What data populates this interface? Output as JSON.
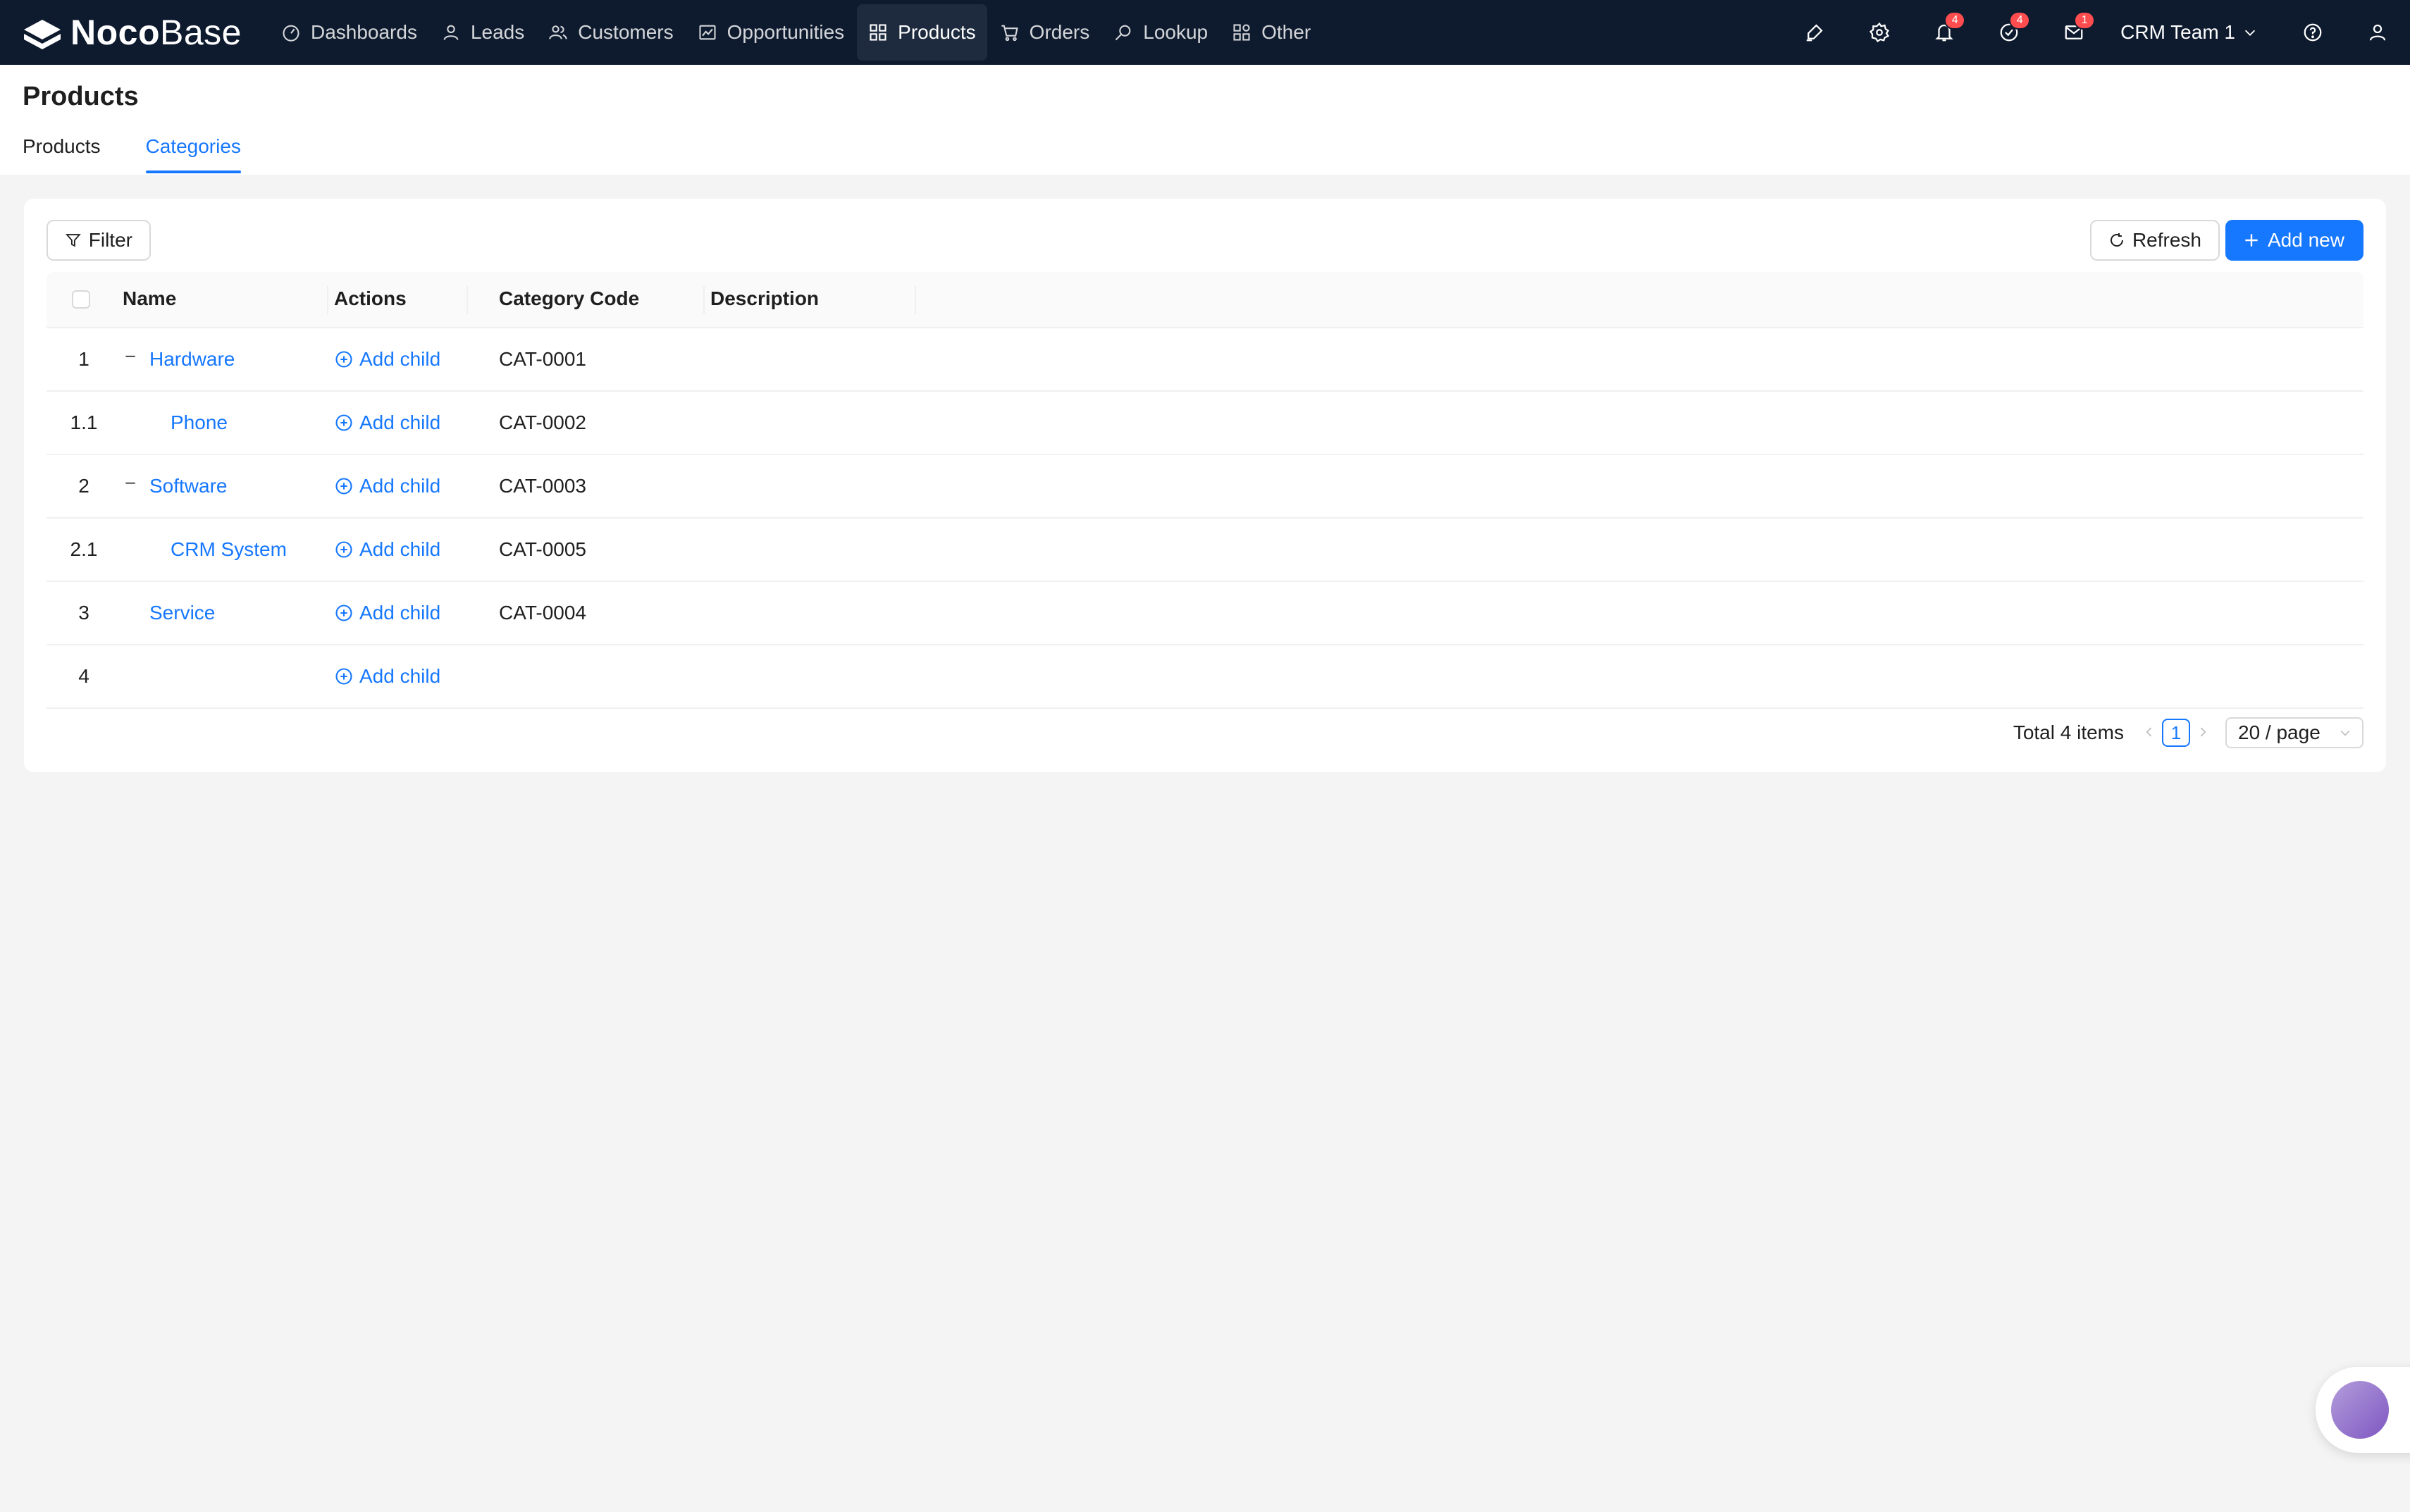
{
  "app": {
    "logo_bold": "Noco",
    "logo_light": "Base"
  },
  "nav": {
    "items": [
      {
        "label": "Dashboards",
        "icon": "dashboard-icon"
      },
      {
        "label": "Leads",
        "icon": "user-icon"
      },
      {
        "label": "Customers",
        "icon": "team-icon"
      },
      {
        "label": "Opportunities",
        "icon": "chart-icon"
      },
      {
        "label": "Products",
        "icon": "grid-icon",
        "active": true
      },
      {
        "label": "Orders",
        "icon": "cart-icon"
      },
      {
        "label": "Lookup",
        "icon": "search-icon"
      },
      {
        "label": "Other",
        "icon": "apps-icon"
      }
    ],
    "badges": {
      "notifications": "4",
      "tasks": "4",
      "mail": "1"
    },
    "team": "CRM Team 1"
  },
  "page": {
    "title": "Products",
    "tabs": [
      "Products",
      "Categories"
    ],
    "active_tab": "Categories"
  },
  "toolbar": {
    "filter": "Filter",
    "refresh": "Refresh",
    "add_new": "Add new"
  },
  "table": {
    "columns": [
      "Name",
      "Actions",
      "Category Code",
      "Description"
    ],
    "rows": [
      {
        "index": "1",
        "name": "Hardware",
        "action": "Add child",
        "code": "CAT-0001",
        "description": "",
        "expandable": true,
        "level": 0
      },
      {
        "index": "1.1",
        "name": "Phone",
        "action": "Add child",
        "code": "CAT-0002",
        "description": "",
        "expandable": false,
        "level": 1
      },
      {
        "index": "2",
        "name": "Software",
        "action": "Add child",
        "code": "CAT-0003",
        "description": "",
        "expandable": true,
        "level": 0
      },
      {
        "index": "2.1",
        "name": "CRM System",
        "action": "Add child",
        "code": "CAT-0005",
        "description": "",
        "expandable": false,
        "level": 1
      },
      {
        "index": "3",
        "name": "Service",
        "action": "Add child",
        "code": "CAT-0004",
        "description": "",
        "expandable": false,
        "level": 0
      },
      {
        "index": "4",
        "name": "",
        "action": "Add child",
        "code": "",
        "description": "",
        "expandable": false,
        "level": 0
      }
    ]
  },
  "pagination": {
    "total": "Total 4 items",
    "current_page": "1",
    "page_size": "20 / page"
  },
  "colors": {
    "nav_bg": "#0e1b2e",
    "primary": "#1677ff",
    "badge": "#ff4d4f"
  }
}
